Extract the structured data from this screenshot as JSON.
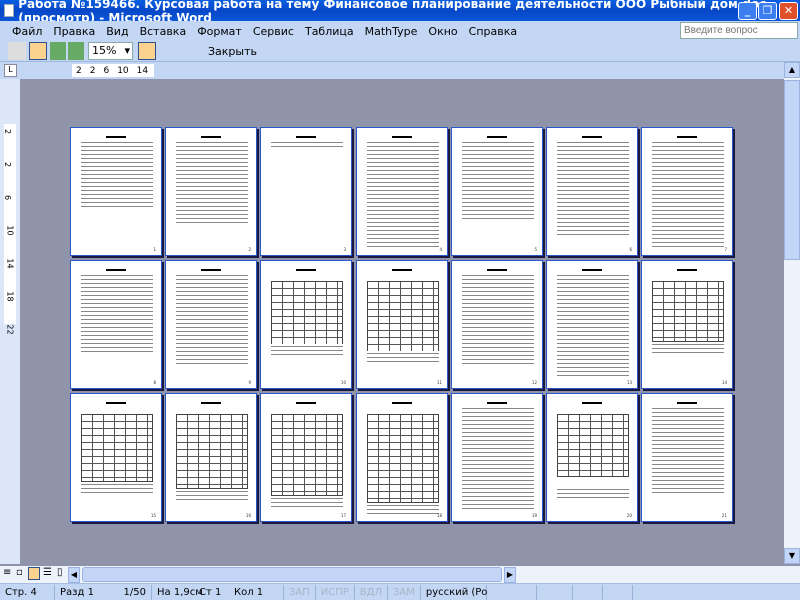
{
  "window": {
    "title": "Работа №159466. Курсовая работа на тему Финансовое планирование деятельности ООО Рыбный дом.doc (просмотр) - Microsoft Word",
    "minimize": "_",
    "restore": "❐",
    "close": "✕"
  },
  "menu": [
    "Файл",
    "Правка",
    "Вид",
    "Вставка",
    "Формат",
    "Сервис",
    "Таблица",
    "MathType",
    "Окно",
    "Справка"
  ],
  "help_placeholder": "Введите вопрос",
  "toolbar": {
    "zoom": "15%",
    "close_label": "Закрыть"
  },
  "ruler": {
    "h_ticks": [
      "2",
      "2",
      "6",
      "10",
      "14"
    ],
    "v_ticks": [
      "2",
      "2",
      "6",
      "10",
      "14",
      "18",
      "22"
    ]
  },
  "pages": [
    "text",
    "text",
    "short",
    "text",
    "text",
    "text",
    "text",
    "text",
    "text",
    "table",
    "table",
    "text",
    "text",
    "table",
    "table",
    "table",
    "table",
    "table",
    "text",
    "table",
    "text"
  ],
  "statusbar": {
    "page": "Стр. 4",
    "section": "Разд 1",
    "count": "1/50",
    "at": "На 1,9см",
    "line": "Ст 1",
    "col": "Кол 1",
    "rec": "ЗАП",
    "trk": "ИСПР",
    "ext": "ВДЛ",
    "ovr": "ЗАМ",
    "lang": "русский (Ро"
  }
}
